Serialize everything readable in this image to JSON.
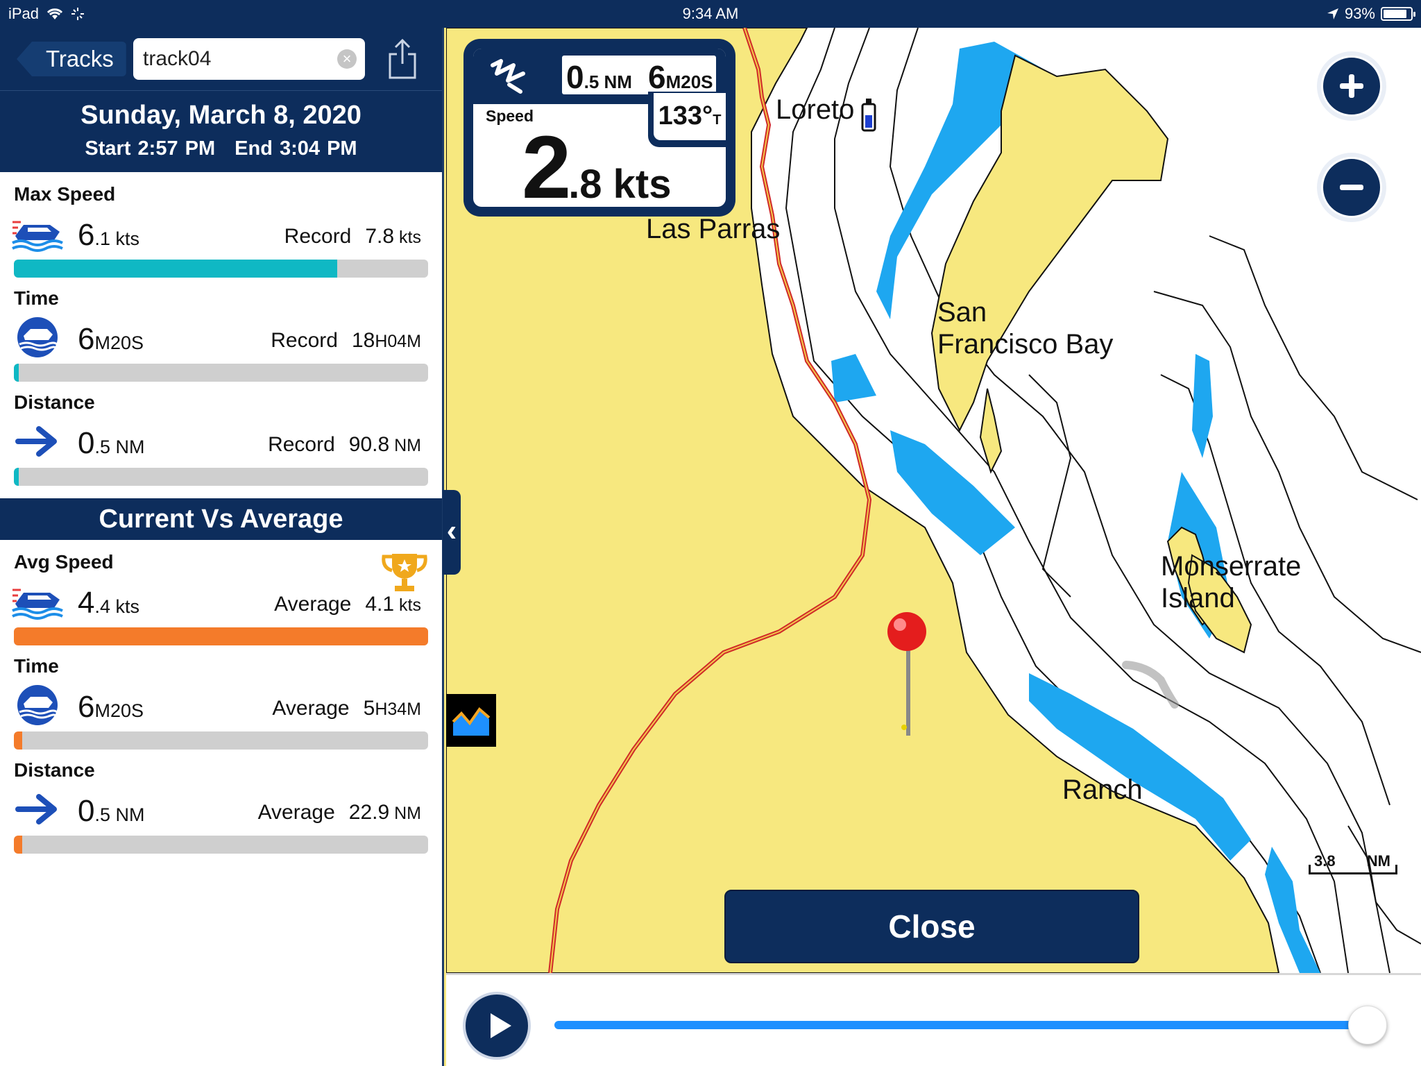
{
  "status_bar": {
    "device": "iPad",
    "time": "9:34 AM",
    "battery": "93%",
    "battery_level": 0.93
  },
  "header": {
    "back_label": "Tracks",
    "search_value": "track04",
    "search_placeholder": ""
  },
  "track": {
    "date": "Sunday, March 8, 2020",
    "start": "Start 2:57 PM",
    "end": "End 3:04 PM"
  },
  "summary": [
    {
      "title": "Max Speed",
      "icon": "boat-speed-icon",
      "value_big": "6",
      "value_small": ".1 kts",
      "ref_label": "Record",
      "ref_big": "7.8",
      "ref_small": " kts",
      "fill": 0.78,
      "color": "#0fb8c4"
    },
    {
      "title": "Time",
      "icon": "boat-time-icon",
      "value_big": "6",
      "value_small": "M20S",
      "ref_label": "Record",
      "ref_big": "18",
      "ref_small": "H04M",
      "fill": 0.006,
      "color": "#0fb8c4"
    },
    {
      "title": "Distance",
      "icon": "arrow-right-icon",
      "value_big": "0",
      "value_small": ".5 NM",
      "ref_label": "Record",
      "ref_big": "90.8",
      "ref_small": " NM",
      "fill": 0.006,
      "color": "#0fb8c4"
    }
  ],
  "comparison": {
    "title": "Current Vs Average",
    "items": [
      {
        "title": "Avg Speed",
        "icon": "boat-speed-icon",
        "value_big": "4",
        "value_small": ".4 kts",
        "ref_label": "Average",
        "ref_big": "4.1",
        "ref_small": " kts",
        "fill": 1.0,
        "color": "#f47b2a",
        "trophy": "trophy-icon"
      },
      {
        "title": "Time",
        "icon": "boat-time-icon",
        "value_big": "6",
        "value_small": "M20S",
        "ref_label": "Average",
        "ref_big": "5",
        "ref_small": "H34M",
        "fill": 0.02,
        "color": "#f47b2a"
      },
      {
        "title": "Distance",
        "icon": "arrow-right-icon",
        "value_big": "0",
        "value_small": ".5 NM",
        "ref_label": "Average",
        "ref_big": "22.9",
        "ref_small": " NM",
        "fill": 0.02,
        "color": "#f47b2a"
      }
    ]
  },
  "speed_widget": {
    "dist_big": "0",
    "dist_small": ".5 NM",
    "time_big": "6",
    "time_small": "M20S",
    "heading_value": "133°",
    "heading_unit": "T",
    "speed_label": "Speed",
    "speed_big": "2",
    "speed_small": ".8 kts"
  },
  "map": {
    "labels": {
      "loreto": "Loreto",
      "las_parras": "Las Parras",
      "san_francisco_bay_1": "San",
      "san_francisco_bay_2": "Francisco Bay",
      "monserrate_1": "Monserrate",
      "monserrate_2": "Island",
      "ranch": "Ranch"
    },
    "scale_value": "3.8",
    "scale_unit": "NM"
  },
  "close_label": "Close",
  "playback": {
    "progress": 1.0
  }
}
